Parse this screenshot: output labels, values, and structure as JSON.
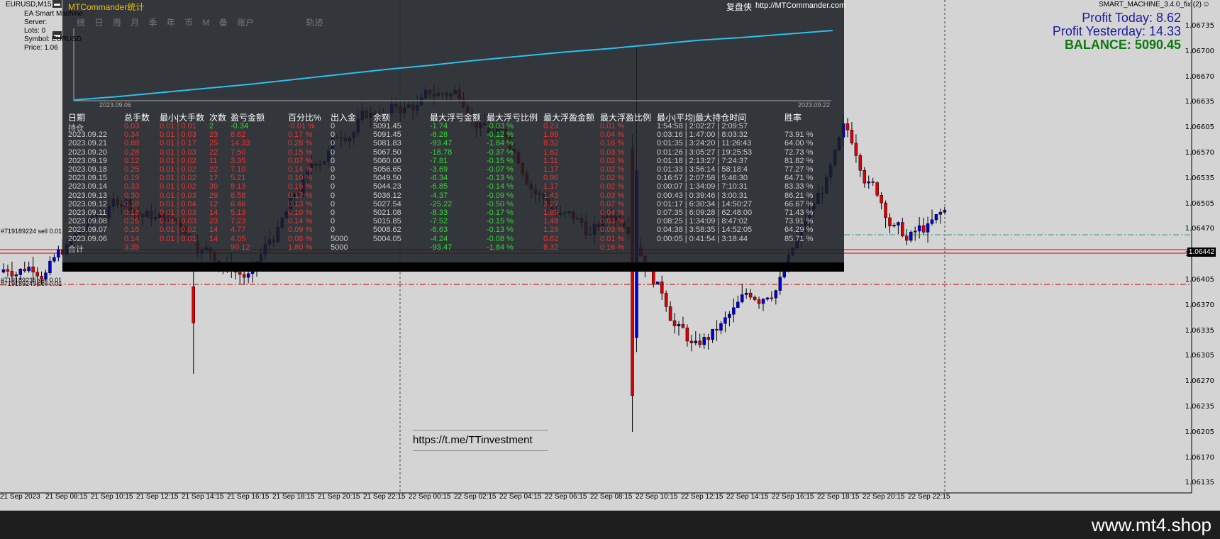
{
  "window": {
    "symbol_label": "EURUSD,M15",
    "close_glyph": "▬",
    "minimize_glyph": "▬"
  },
  "ea_info": {
    "lines": [
      "EA Smart Machine",
      "Server: ",
      "Lots: 0",
      "Symbol: EURUSD",
      "Price: 1.06"
    ]
  },
  "expert": {
    "name": "SMART_MACHINE_3.4.0_fix (2)",
    "icon": "smile-icon"
  },
  "profit": {
    "today": "Profit Today: 8.62",
    "yesterday": "Profit Yesterday: 14.33",
    "balance": "BALANCE: 5090.45"
  },
  "panel": {
    "title": "MTCommander统计",
    "brand": "复盘侠",
    "url": "http://MTCommander.com",
    "tabs": [
      "统",
      "日",
      "周",
      "月",
      "季",
      "年",
      "币",
      "M",
      "备",
      "账户",
      "",
      "轨迹"
    ],
    "equity_dates": [
      "2023.09.06",
      "2023.09.22"
    ],
    "equity_curve": [
      0.0,
      0.05,
      0.11,
      0.17,
      0.23,
      0.3,
      0.37,
      0.44,
      0.5,
      0.57,
      0.63,
      0.69,
      0.74,
      0.8,
      0.86,
      0.9,
      0.95,
      1.0
    ]
  },
  "stats": {
    "headers": [
      "日期",
      "总手数",
      "最小|大手数",
      "次数",
      "盈亏金额",
      "百分比%",
      "出入金",
      "余额",
      "最大浮亏金额",
      "最大浮亏比例",
      "最大浮盈金额",
      "最大浮盈比例",
      "最小|平均|最大持仓时间",
      "胜率"
    ],
    "rows": [
      [
        "持仓",
        "0.03",
        "0.01 | 0.01",
        "2",
        "-0.34",
        "-0.01 %",
        "0",
        "5091.45",
        "-1.74",
        "-0.03 %",
        "0.23",
        "0.01 %",
        "1:54:58 | 2:02:27 | 2:09:57",
        ""
      ],
      [
        "2023.09.22",
        "0.34",
        "0.01 | 0.03",
        "23",
        "8.62",
        "0.17 %",
        "0",
        "5091.45",
        "-6.28",
        "-0.12 %",
        "1.99",
        "0.04 %",
        "0:03:16 | 1:47:00 | 8:03:32",
        "73.91 %"
      ],
      [
        "2023.09.21",
        "0.88",
        "0.01 | 0.17",
        "25",
        "14.33",
        "0.28 %",
        "0",
        "5081.83",
        "-93.47",
        "-1.84 %",
        "8.32",
        "0.16 %",
        "0:01:35 | 3:24:20 | 11:26:43",
        "64.00 %"
      ],
      [
        "2023.09.20",
        "0.28",
        "0.01 | 0.03",
        "22",
        "7.50",
        "0.15 %",
        "0",
        "5067.50",
        "-18.78",
        "-0.37 %",
        "1.62",
        "0.03 %",
        "0:01:26 | 3:05:27 | 19:25:53",
        "72.73 %"
      ],
      [
        "2023.09.19",
        "0.12",
        "0.01 | 0.02",
        "11",
        "3.35",
        "0.07 %",
        "0",
        "5060.00",
        "-7.81",
        "-0.15 %",
        "1.11",
        "0.02 %",
        "0:01:18 | 2:13:27 | 7:24:37",
        "81.82 %"
      ],
      [
        "2023.09.18",
        "0.25",
        "0.01 | 0.02",
        "22",
        "7.10",
        "0.14 %",
        "0",
        "5056.65",
        "-3.69",
        "-0.07 %",
        "1.17",
        "0.02 %",
        "0:01:33 | 3:56:14 | 58:18:4",
        "77.27 %"
      ],
      [
        "2023.09.15",
        "0.19",
        "0.01 | 0.02",
        "17",
        "5.21",
        "0.10 %",
        "0",
        "5049.50",
        "-6.34",
        "-0.13 %",
        "0.96",
        "0.02 %",
        "0:16:57 | 2:07:58 | 5:46:30",
        "64.71 %"
      ],
      [
        "2023.09.14",
        "0.33",
        "0.01 | 0.02",
        "30",
        "8.13",
        "0.16 %",
        "0",
        "5044.23",
        "-6.85",
        "-0.14 %",
        "1.17",
        "0.02 %",
        "0:00:07 | 1:34:09 | 7:10:31",
        "83.33 %"
      ],
      [
        "2023.09.13",
        "0.30",
        "0.01 | 0.03",
        "29",
        "8.58",
        "0.17 %",
        "0",
        "5036.12",
        "-4.37",
        "-0.09 %",
        "1.43",
        "0.03 %",
        "0:00:43 | 0:39:46 | 3:00:31",
        "86.21 %"
      ],
      [
        "2023.09.12",
        "0.18",
        "0.01 | 0.04",
        "12",
        "6.46",
        "0.13 %",
        "0",
        "5027.54",
        "-25.22",
        "-0.50 %",
        "3.27",
        "0.07 %",
        "0:01:17 | 6:30:34 | 14:50:27",
        "66.67 %"
      ],
      [
        "2023.09.11",
        "0.18",
        "0.01 | 0.03",
        "14",
        "5.13",
        "0.10 %",
        "0",
        "5021.08",
        "-8.33",
        "-0.17 %",
        "1.89",
        "0.04 %",
        "0:07:35 | 6:09:28 | 62:48:00",
        "71.43 %"
      ],
      [
        "2023.09.08",
        "0.26",
        "0.01 | 0.03",
        "23",
        "7.23",
        "0.14 %",
        "0",
        "5015.85",
        "-7.52",
        "-0.15 %",
        "1.48",
        "0.03 %",
        "0:08:25 | 1:34:09 | 8:47:02",
        "73.91 %"
      ],
      [
        "2023.09.07",
        "0.16",
        "0.01 | 0.02",
        "14",
        "4.77",
        "0.09 %",
        "0",
        "5008.62",
        "-6.63",
        "-0.13 %",
        "1.29",
        "0.03 %",
        "0:04:38 | 3:58:35 | 14:52:05",
        "64.29 %"
      ],
      [
        "2023.09.06",
        "0.14",
        "0.01 | 0.01",
        "14",
        "4.05",
        "0.08 %",
        "5000",
        "5004.05",
        "-4.24",
        "-0.08 %",
        "0.62",
        "0.01 %",
        "0:00:05 | 0:41:54 | 3:18:44",
        "85.71 %"
      ],
      [
        "合计",
        "3.35",
        "",
        "",
        "90.12",
        "1.80 %",
        "5000",
        "",
        "-93.47",
        "-1.84 %",
        "8.32",
        "0.16 %",
        "",
        ""
      ]
    ]
  },
  "chart": {
    "watermark_link": "https://t.me/TTinvestment",
    "orders": [
      "#719189224 sell 0.01",
      "#719189236 sell 0.01",
      "#719189249 sell 0.01"
    ],
    "current_price": "1.06442",
    "price_labels": [
      "1.06735",
      "1.06700",
      "1.06670",
      "1.06635",
      "1.06605",
      "1.06570",
      "1.06535",
      "1.06505",
      "1.06470",
      "1.06435",
      "1.06405",
      "1.06370",
      "1.06335",
      "1.06305",
      "1.06270",
      "1.06235",
      "1.06205",
      "1.06170",
      "1.06135"
    ],
    "time_labels": [
      "21 Sep 2023",
      "21 Sep 08:15",
      "21 Sep 10:15",
      "21 Sep 12:15",
      "21 Sep 14:15",
      "21 Sep 16:15",
      "21 Sep 18:15",
      "21 Sep 20:15",
      "21 Sep 22:15",
      "22 Sep 00:15",
      "22 Sep 02:15",
      "22 Sep 04:15",
      "22 Sep 06:15",
      "22 Sep 08:15",
      "22 Sep 10:15",
      "22 Sep 12:15",
      "22 Sep 14:15",
      "22 Sep 16:15",
      "22 Sep 18:15",
      "22 Sep 20:15",
      "22 Sep 22:15"
    ],
    "bull_color": "#0000dd",
    "bear_color": "#dd0000"
  },
  "footer": {
    "site": "www.mt4.shop"
  }
}
